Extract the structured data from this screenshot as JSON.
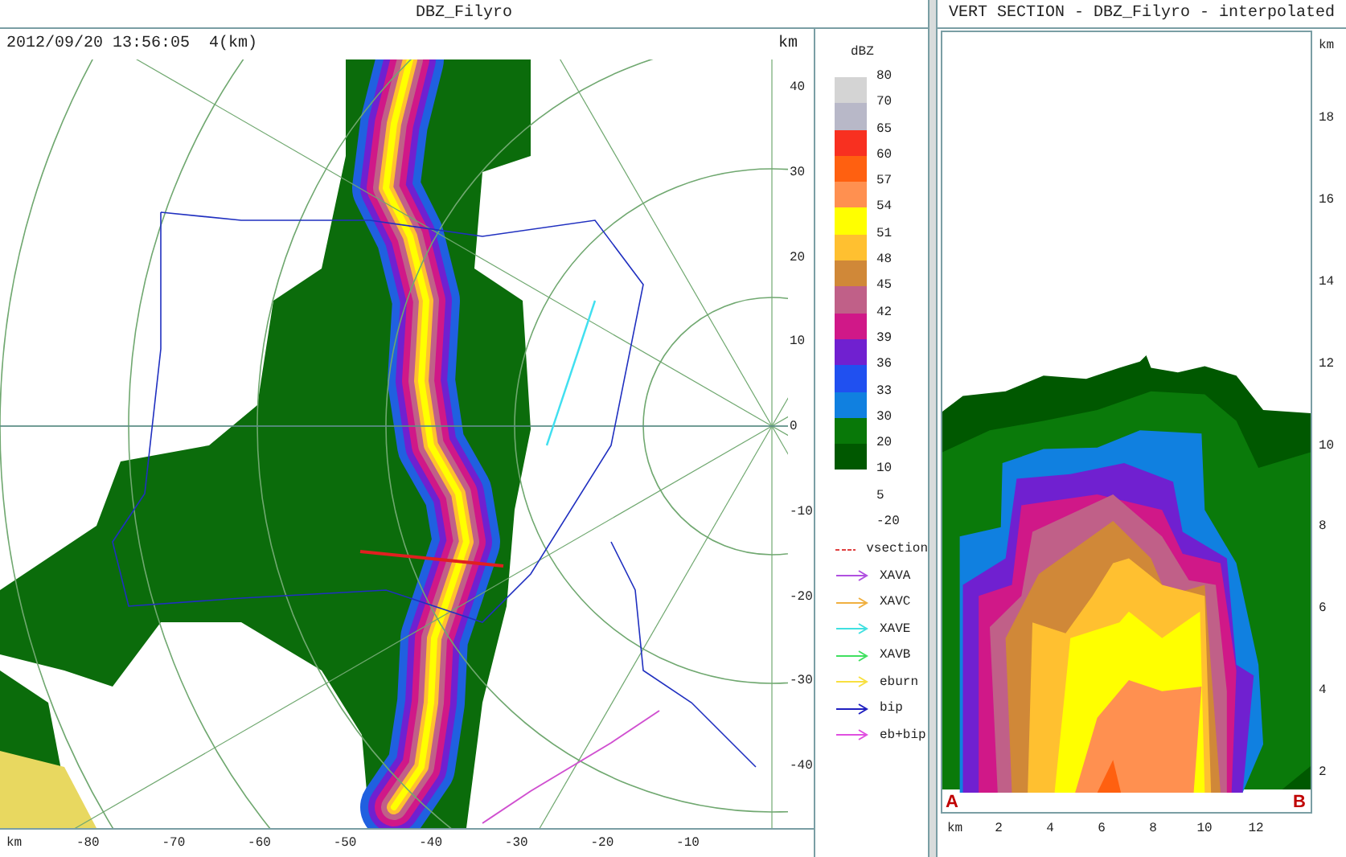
{
  "radar_panel": {
    "title": "DBZ_Filyro",
    "timestamp": "2012/09/20 13:56:05  4(km)",
    "y_unit": "km",
    "y_ticks": [
      "40",
      "30",
      "20",
      "10",
      "0",
      "-10",
      "-20",
      "-30",
      "-40"
    ],
    "x_unit": "km",
    "x_ticks": [
      "-80",
      "-70",
      "-60",
      "-50",
      "-40",
      "-30",
      "-20",
      "-10"
    ]
  },
  "legend": {
    "title": "dBZ",
    "scale": [
      {
        "label": "80",
        "color": "#d4d4d4"
      },
      {
        "label": "70",
        "color": "#b8b8c8"
      },
      {
        "label": "65",
        "color": "#f83020"
      },
      {
        "label": "60",
        "color": "#ff6010"
      },
      {
        "label": "57",
        "color": "#ff9050"
      },
      {
        "label": "54",
        "color": "#ffff00"
      },
      {
        "label": "51",
        "color": "#ffc030"
      },
      {
        "label": "48",
        "color": "#d08838"
      },
      {
        "label": "45",
        "color": "#c06088"
      },
      {
        "label": "42",
        "color": "#d01888"
      },
      {
        "label": "39",
        "color": "#7020d0"
      },
      {
        "label": "36",
        "color": "#2050f0"
      },
      {
        "label": "33",
        "color": "#1080e0"
      },
      {
        "label": "30",
        "color": "#087808"
      },
      {
        "label": "20",
        "color": "#005800"
      },
      {
        "label": "10"
      },
      {
        "label": "5"
      },
      {
        "label": "-20"
      }
    ],
    "lines": [
      {
        "label": "vsection",
        "color": "#e04040",
        "kind": "dashed"
      },
      {
        "label": "XAVA",
        "color": "#b050e0",
        "kind": "arrow"
      },
      {
        "label": "XAVC",
        "color": "#f0b040",
        "kind": "arrow"
      },
      {
        "label": "XAVE",
        "color": "#40e0e0",
        "kind": "arrow"
      },
      {
        "label": "XAVB",
        "color": "#40e060",
        "kind": "arrow"
      },
      {
        "label": "eburn",
        "color": "#f8e040",
        "kind": "arrow"
      },
      {
        "label": "bip",
        "color": "#2020c0",
        "kind": "arrow"
      },
      {
        "label": "eb+bip",
        "color": "#e050e0",
        "kind": "arrow"
      }
    ]
  },
  "vertical_section": {
    "title": "VERT SECTION - DBZ_Filyro - interpolated",
    "start_label": "A",
    "end_label": "B",
    "y_unit": "km",
    "y_ticks": [
      "18",
      "16",
      "14",
      "12",
      "10",
      "8",
      "6",
      "4",
      "2"
    ],
    "x_unit": "km",
    "x_ticks": [
      "2",
      "4",
      "6",
      "8",
      "10",
      "12"
    ]
  }
}
